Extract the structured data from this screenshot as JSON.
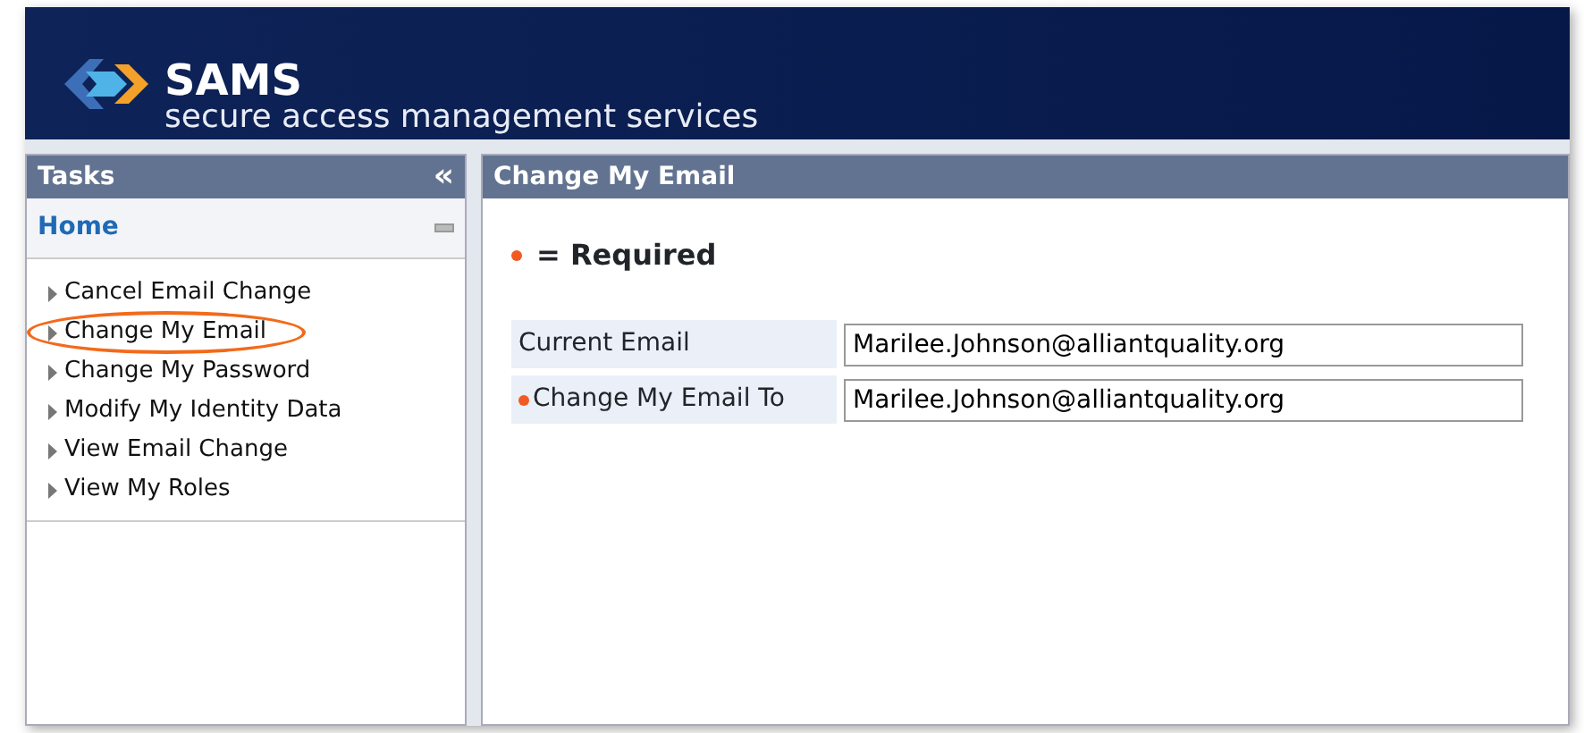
{
  "header": {
    "title": "SAMS",
    "subtitle": "secure access management services"
  },
  "sidebar": {
    "title": "Tasks",
    "collapse_glyph": "«",
    "section": "Home",
    "items": [
      {
        "label": "Cancel Email Change",
        "circled": false
      },
      {
        "label": "Change My Email",
        "circled": true
      },
      {
        "label": "Change My Password",
        "circled": false
      },
      {
        "label": "Modify My Identity Data",
        "circled": false
      },
      {
        "label": "View Email Change",
        "circled": false
      },
      {
        "label": "View My Roles",
        "circled": false
      }
    ]
  },
  "main": {
    "title": "Change My Email",
    "legend": "= Required",
    "fields": [
      {
        "label": "Current Email",
        "value": "Marilee.Johnson@alliantquality.org",
        "required": false
      },
      {
        "label": "Change My Email To",
        "value": "Marilee.Johnson@alliantquality.org",
        "required": true
      }
    ]
  }
}
